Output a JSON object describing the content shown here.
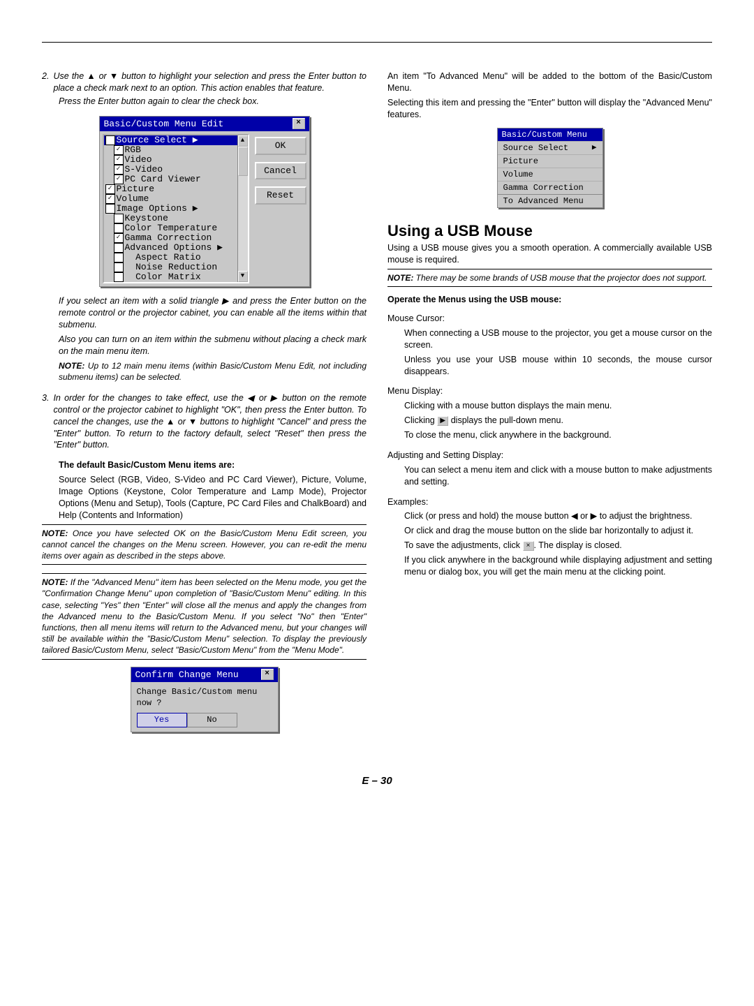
{
  "left": {
    "step2a": "Use the ▲ or ▼ button to highlight your selection and press the Enter button to place a check mark next to an option. This action enables that feature.",
    "step2b": "Press the Enter button again to clear the check box.",
    "para1": "If you select an item with a solid triangle ▶ and press the Enter button on the remote control or the projector cabinet, you can enable all the items within that submenu.",
    "para2": "Also you can turn on an item within the submenu without placing a check mark on the main menu item.",
    "note1_label": "NOTE:",
    "note1": " Up to 12 main menu items (within Basic/Custom Menu Edit, not including submenu items) can be selected.",
    "step3": "In order for the changes to take effect, use the ◀ or ▶ button on the remote control or the projector cabinet to highlight \"OK\", then press the Enter button. To cancel the changes, use the ▲ or ▼ buttons to highlight \"Cancel\" and press the \"Enter\" button. To return to the factory default, select \"Reset\" then press the \"Enter\" button.",
    "default_head": "The default Basic/Custom Menu items are:",
    "default_body": "Source Select (RGB, Video, S-Video and PC Card Viewer), Picture, Volume, Image Options (Keystone, Color Temperature and Lamp Mode), Projector Options (Menu and Setup), Tools (Capture, PC Card Files and ChalkBoard) and Help (Contents and Information)",
    "note2_label": "NOTE:",
    "note2": " Once you have selected OK on the Basic/Custom Menu Edit screen, you cannot cancel the changes on the Menu screen. However, you can re-edit the menu items over again as described in the steps above.",
    "note3_label": "NOTE:",
    "note3": " If the \"Advanced Menu\" item has been selected on the Menu mode, you get the \"Confirmation Change Menu\" upon completion of \"Basic/Custom Menu\" editing. In this case, selecting \"Yes\" then \"Enter\" will close all the menus and apply the changes from the Advanced menu to the Basic/Custom Menu. If you select \"No\" then \"Enter\" functions, then all menu items will return to the Advanced menu, but your changes will still be available within the \"Basic/Custom Menu\" selection. To display the previously tailored Basic/Custom Menu, select \"Basic/Custom Menu\" from the \"Menu Mode\"."
  },
  "right": {
    "p1": "An item \"To Advanced Menu\" will be added to the bottom of the Basic/Custom Menu.",
    "p2": "Selecting this item and pressing the \"Enter\" button will display the \"Advanced Menu\" features.",
    "h2": "Using a USB Mouse",
    "p3": "Using  a  USB  mouse gives you a smooth operation. A commercially available USB mouse is required.",
    "note_label": "NOTE:",
    "note": " There may be some brands of USB mouse that the projector does not support.",
    "sub1": "Operate the Menus using the USB mouse:",
    "mc_h": "Mouse Cursor:",
    "mc1": "When connecting a USB mouse to the projector, you get a mouse cursor on the screen.",
    "mc2": "Unless you use your USB mouse within 10 seconds, the mouse cursor disappears.",
    "md_h": "Menu Display:",
    "md1": "Clicking with a mouse button displays the main menu.",
    "md2a": "Clicking ",
    "md2b": " displays the pull-down menu.",
    "md3": "To close the menu, click anywhere in the background.",
    "as_h": "Adjusting and Setting Display:",
    "as1": "You can select a menu item and click with a mouse button to make adjustments and setting.",
    "ex_h": "Examples:",
    "ex1": "Click (or press and hold) the mouse button ◀ or ▶ to adjust the brightness.",
    "ex2": "Or click and drag the mouse button on the slide bar horizontally to adjust it.",
    "ex3a": "To save the adjustments, click ",
    "ex3b": ". The display is closed.",
    "ex4": "If you click anywhere in the background while displaying adjustment and setting menu or dialog box, you will get the main menu at the clicking point."
  },
  "ui_edit": {
    "title": "Basic/Custom Menu Edit",
    "items": [
      {
        "checked": true,
        "sub": false,
        "label": "Source Select ▶",
        "hl": true
      },
      {
        "checked": true,
        "sub": true,
        "label": "RGB"
      },
      {
        "checked": true,
        "sub": true,
        "label": "Video"
      },
      {
        "checked": true,
        "sub": true,
        "label": "S-Video"
      },
      {
        "checked": true,
        "sub": true,
        "label": "PC Card Viewer"
      },
      {
        "checked": true,
        "sub": false,
        "label": "Picture"
      },
      {
        "checked": true,
        "sub": false,
        "label": "Volume"
      },
      {
        "checked": false,
        "sub": false,
        "label": "Image Options ▶"
      },
      {
        "checked": false,
        "sub": true,
        "label": "Keystone"
      },
      {
        "checked": false,
        "sub": true,
        "label": "Color Temperature"
      },
      {
        "checked": true,
        "sub": true,
        "label": "Gamma Correction"
      },
      {
        "checked": false,
        "sub": true,
        "label": "Advanced Options ▶"
      },
      {
        "checked": false,
        "sub": true,
        "label": "  Aspect Ratio"
      },
      {
        "checked": false,
        "sub": true,
        "label": "  Noise Reduction"
      },
      {
        "checked": false,
        "sub": true,
        "label": "  Color Matrix"
      }
    ],
    "buttons": {
      "ok": "OK",
      "cancel": "Cancel",
      "reset": "Reset"
    }
  },
  "ui_menu": {
    "title": "Basic/Custom Menu",
    "rows": [
      "Source Select",
      "Picture",
      "Volume",
      "Gamma Correction",
      "To Advanced Menu"
    ]
  },
  "ui_confirm": {
    "title": "Confirm Change Menu",
    "msg": "Change Basic/Custom menu now ?",
    "yes": "Yes",
    "no": "No"
  },
  "pager": "E – 30"
}
